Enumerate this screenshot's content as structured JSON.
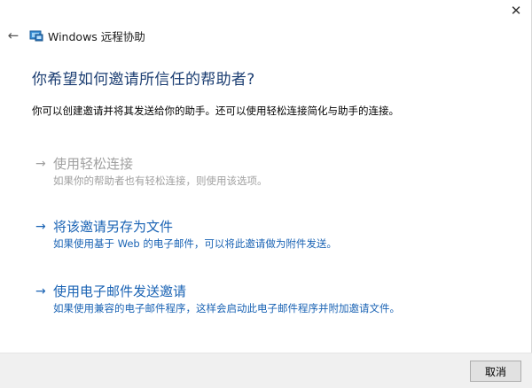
{
  "window": {
    "title": "Windows 远程协助",
    "close_glyph": "✕",
    "back_glyph": "←"
  },
  "heading": "你希望如何邀请所信任的帮助者?",
  "description": "你可以创建邀请并将其发送给你的助手。还可以使用轻松连接简化与助手的连接。",
  "options": [
    {
      "arrow": "→",
      "title": "使用轻松连接",
      "subtitle": "如果你的帮助者也有轻松连接，则使用该选项。",
      "enabled": false
    },
    {
      "arrow": "→",
      "title": "将该邀请另存为文件",
      "subtitle": "如果使用基于 Web 的电子邮件，可以将此邀请做为附件发送。",
      "enabled": true
    },
    {
      "arrow": "→",
      "title": "使用电子邮件发送邀请",
      "subtitle": "如果使用兼容的电子邮件程序，这样会启动此电子邮件程序并附加邀请文件。",
      "enabled": true
    }
  ],
  "footer": {
    "cancel_label": "取消"
  },
  "colors": {
    "heading": "#1d3f73",
    "link": "#1a63b4",
    "disabled": "#a0a0a0",
    "footer_bg": "#f0f0f0"
  },
  "icons": {
    "app": "remote-assistance-icon",
    "back": "back-arrow-icon",
    "close": "close-icon"
  }
}
